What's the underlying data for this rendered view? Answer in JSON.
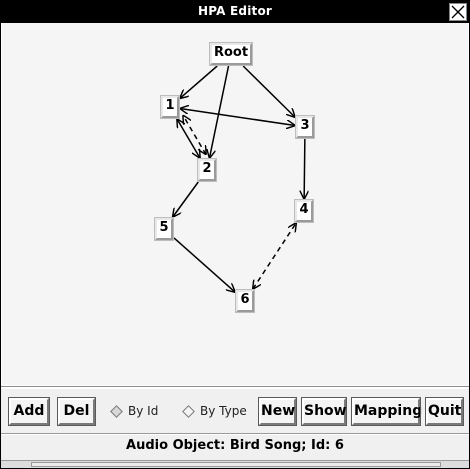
{
  "window": {
    "title": "HPA Editor"
  },
  "graph": {
    "nodes": [
      {
        "id": "root",
        "label": "Root"
      },
      {
        "id": "n1",
        "label": "1"
      },
      {
        "id": "n2",
        "label": "2"
      },
      {
        "id": "n3",
        "label": "3"
      },
      {
        "id": "n4",
        "label": "4"
      },
      {
        "id": "n5",
        "label": "5"
      },
      {
        "id": "n6",
        "label": "6"
      }
    ],
    "edges": [
      {
        "from": "root",
        "to": "n1",
        "style": "solid",
        "arrows": "end"
      },
      {
        "from": "root",
        "to": "n2",
        "style": "solid",
        "arrows": "end"
      },
      {
        "from": "root",
        "to": "n3",
        "style": "solid",
        "arrows": "end"
      },
      {
        "from": "n1",
        "to": "n3",
        "style": "solid",
        "arrows": "both"
      },
      {
        "from": "n1",
        "to": "n2",
        "style": "solid",
        "arrows": "both"
      },
      {
        "from": "n2",
        "to": "n1",
        "style": "dashed",
        "arrows": "both"
      },
      {
        "from": "n3",
        "to": "n4",
        "style": "solid",
        "arrows": "end"
      },
      {
        "from": "n2",
        "to": "n5",
        "style": "solid",
        "arrows": "end"
      },
      {
        "from": "n5",
        "to": "n6",
        "style": "solid",
        "arrows": "end"
      },
      {
        "from": "n6",
        "to": "n4",
        "style": "dashed",
        "arrows": "both"
      }
    ]
  },
  "toolbar": {
    "add_label": "Add",
    "del_label": "Del",
    "by_id_label": "By Id",
    "by_type_label": "By Type",
    "new_label": "New",
    "show_label": "Show",
    "mapping_label": "Mapping",
    "quit_label": "Quit"
  },
  "status": {
    "text": "Audio Object: Bird Song; Id: 6"
  }
}
